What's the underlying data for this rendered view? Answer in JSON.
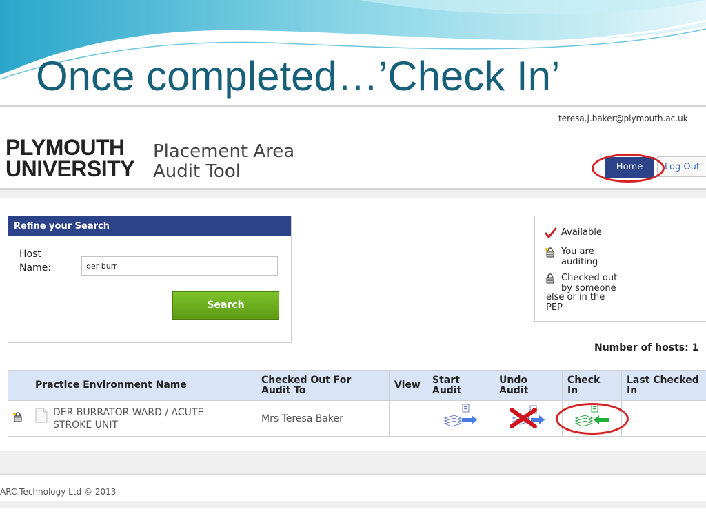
{
  "slide": {
    "title": "Once completed…’Check In’"
  },
  "header": {
    "user_email": "teresa.j.baker@plymouth.ac.uk",
    "logo_line1": "PLYMOUTH",
    "logo_line2": "UNIVERSITY",
    "app_title_line1": "Placement Area",
    "app_title_line2": "Audit Tool",
    "nav": {
      "home": "Home",
      "logout": "Log Out"
    }
  },
  "search": {
    "panel_title": "Refine your Search",
    "host_label_line1": "Host",
    "host_label_line2": "Name:",
    "host_value": "der burr",
    "button_label": "Search"
  },
  "legend": {
    "available": "Available",
    "you_are_line1": "You are",
    "you_are_line2": "auditing",
    "checked_out_line1": "Checked out",
    "checked_out_line2": "by someone",
    "checked_out_line3": "else or in the",
    "checked_out_line4": "PEP"
  },
  "results": {
    "count_text": "Number of hosts: 1",
    "columns": {
      "status": "",
      "name": "Practice Environment Name",
      "checked_out_line1": "Checked Out For",
      "checked_out_line2": "Audit To",
      "view": "View",
      "start_line1": "Start",
      "start_line2": "Audit",
      "undo_line1": "Undo",
      "undo_line2": "Audit",
      "checkin_line1": "Check",
      "checkin_line2": "In",
      "last_line1": "Last Checked",
      "last_line2": "In"
    },
    "rows": [
      {
        "name_line1": "DER BURRATOR WARD / ACUTE",
        "name_line2": "STROKE UNIT",
        "checked_out_to": "Mrs Teresa Baker",
        "view": "",
        "last_checked_in": ""
      }
    ]
  },
  "footer": {
    "copyright": "ARC Technology Ltd © 2013"
  },
  "colors": {
    "title_teal": "#17607a",
    "nav_navy": "#2d4389",
    "search_green": "#6aab1e",
    "table_header_blue": "#d9e5f6",
    "annotation_red": "#d42226"
  },
  "icons": {
    "legend": [
      "checkmark-icon",
      "lock-key-icon",
      "lock-icon"
    ],
    "row": [
      "lock-key-icon",
      "document-icon",
      "start-audit-icon",
      "undo-audit-icon",
      "check-in-icon"
    ]
  }
}
